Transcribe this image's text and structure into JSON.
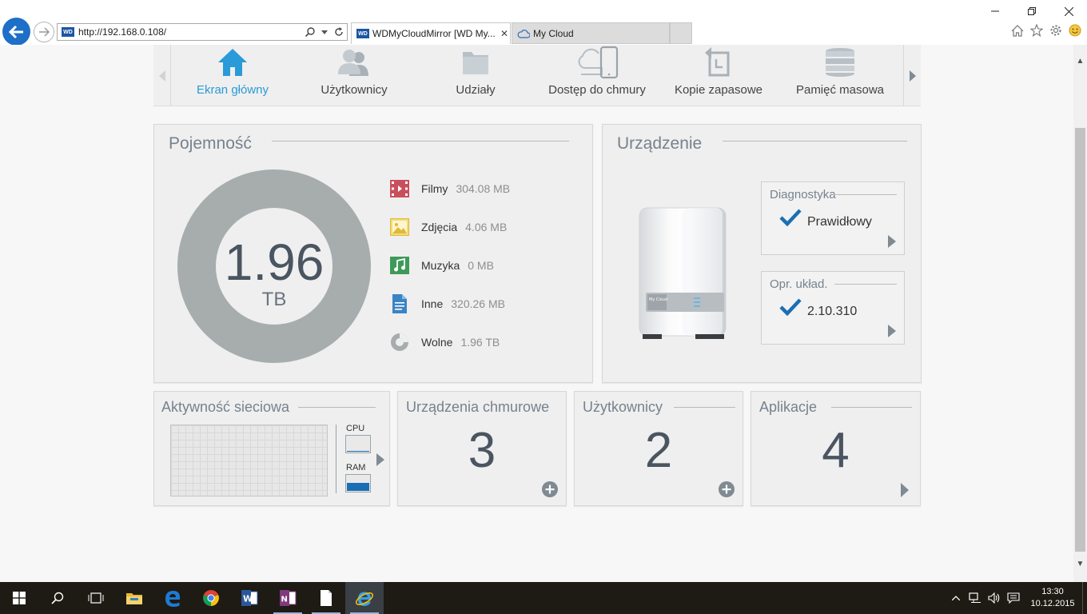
{
  "browser": {
    "url": "http://192.168.0.108/",
    "site_icon": "WD",
    "tabs": [
      {
        "label": "WDMyCloudMirror [WD My...",
        "active": true
      },
      {
        "label": "My Cloud",
        "active": false
      }
    ],
    "accent": "#1d6fc7"
  },
  "nav": {
    "items": [
      {
        "label": "Ekran główny",
        "icon": "home-icon",
        "active": true
      },
      {
        "label": "Użytkownicy",
        "icon": "users-icon",
        "active": false
      },
      {
        "label": "Udziały",
        "icon": "folder-icon",
        "active": false
      },
      {
        "label": "Dostęp do chmury",
        "icon": "cloud-device-icon",
        "active": false
      },
      {
        "label": "Kopie zapasowe",
        "icon": "backup-icon",
        "active": false
      },
      {
        "label": "Pamięć masowa",
        "icon": "storage-icon",
        "active": false
      }
    ],
    "active_color": "#2a9ad8"
  },
  "capacity": {
    "title": "Pojemność",
    "value": "1.96",
    "unit": "TB",
    "categories": [
      {
        "name": "Filmy",
        "value": "304.08 MB",
        "icon": "film-icon",
        "color": "#c94f5c"
      },
      {
        "name": "Zdjęcia",
        "value": "4.06 MB",
        "icon": "photo-icon",
        "color": "#e8c44a"
      },
      {
        "name": "Muzyka",
        "value": "0 MB",
        "icon": "music-icon",
        "color": "#3d9a5a"
      },
      {
        "name": "Inne",
        "value": "320.26 MB",
        "icon": "document-icon",
        "color": "#3b84c4"
      },
      {
        "name": "Wolne",
        "value": "1.96 TB",
        "icon": "free-space-icon",
        "color": "#a7adad"
      }
    ],
    "donut_color": "#a7adad"
  },
  "device": {
    "title": "Urządzenie",
    "nas_label": "My Cloud",
    "diagnostics": {
      "title": "Diagnostyka",
      "value": "Prawidłowy"
    },
    "firmware": {
      "title": "Opr. układ.",
      "value": "2.10.310"
    },
    "check_color": "#1a6fb4"
  },
  "network": {
    "title": "Aktywność sieciowa",
    "cpu_label": "CPU",
    "ram_label": "RAM",
    "cpu_usage": 0.05,
    "ram_usage": 0.55
  },
  "cloud_devices": {
    "title": "Urządzenia chmurowe",
    "count": "3"
  },
  "users": {
    "title": "Użytkownicy",
    "count": "2"
  },
  "apps": {
    "title": "Aplikacje",
    "count": "4"
  },
  "taskbar": {
    "time": "13:30",
    "date": "10.12.2015",
    "apps": [
      "start-icon",
      "search-icon",
      "task-view-icon",
      "file-explorer-icon",
      "edge-icon",
      "chrome-icon",
      "word-icon",
      "onenote-icon",
      "notepad-icon",
      "internet-explorer-icon"
    ]
  }
}
